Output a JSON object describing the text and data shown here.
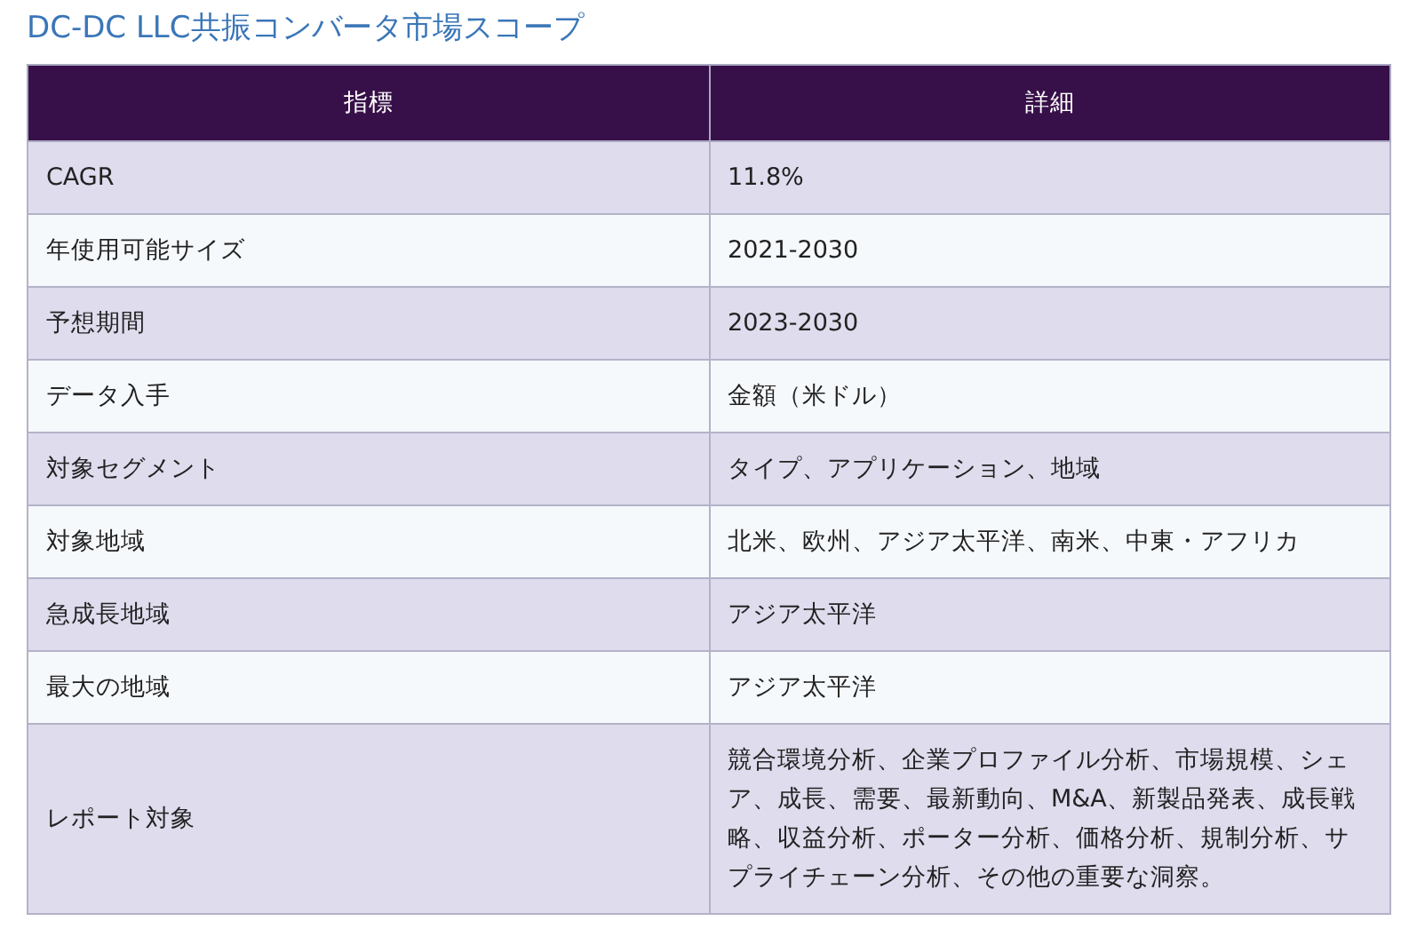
{
  "title": "DC-DC LLC共振コンバータ市場スコープ",
  "table": {
    "columns": [
      "指標",
      "詳細"
    ],
    "rows": [
      {
        "metric": "CAGR",
        "detail": "11.8%"
      },
      {
        "metric": "年使用可能サイズ",
        "detail": "2021-2030"
      },
      {
        "metric": "予想期間",
        "detail": "2023-2030"
      },
      {
        "metric": "データ入手",
        "detail": "金額（米ドル）"
      },
      {
        "metric": "対象セグメント",
        "detail": "タイプ、アプリケーション、地域"
      },
      {
        "metric": "対象地域",
        "detail": "北米、欧州、アジア太平洋、南米、中東・アフリカ"
      },
      {
        "metric": "急成長地域",
        "detail": "アジア太平洋"
      },
      {
        "metric": "最大の地域",
        "detail": "アジア太平洋"
      },
      {
        "metric": "レポート対象",
        "detail": "競合環境分析、企業プロファイル分析、市場規模、シェア、成長、需要、最新動向、M&A、新製品発表、成長戦略、収益分析、ポーター分析、価格分析、規制分析、サプライチェーン分析、その他の重要な洞察。"
      }
    ]
  }
}
